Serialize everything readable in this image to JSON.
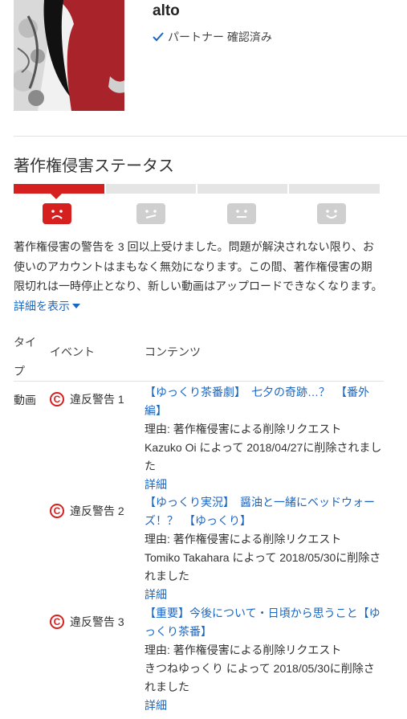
{
  "channel": {
    "name": "alto",
    "verified_label": "パートナー 確認済み"
  },
  "section_title": "著作権侵害ステータス",
  "status": {
    "level_index": 0,
    "levels": 4,
    "accent_color": "#d62020",
    "inactive_color": "#cfcfcf"
  },
  "description": {
    "text": "著作権侵害の警告を 3 回以上受けました。問題が解決されない限り、お使いのアカウントはまもなく無効になります。この間、著作権侵害の期限切れは一時停止となり、新しい動画はアップロードできなくなります。",
    "more_link": "詳細を表示"
  },
  "table": {
    "headers": {
      "type": "タイプ",
      "event": "イベント",
      "content": "コンテンツ"
    },
    "type_value": "動画",
    "rows": [
      {
        "event": "違反警告 1",
        "title": "【ゆっくり茶番劇】　七夕の奇跡…？　【番外編】",
        "reason": "理由: 著作権侵害による削除リクエスト",
        "removed_by": "Kazuko Oi によって 2018/04/27に削除されました",
        "details": "詳細"
      },
      {
        "event": "違反警告 2",
        "title": "【ゆっくり実況】　醤油と一緒にベッドウォーズ！？　【ゆっくり】",
        "reason": "理由: 著作権侵害による削除リクエスト",
        "removed_by": "Tomiko Takahara によって 2018/05/30に削除されました",
        "details": "詳細"
      },
      {
        "event": "違反警告 3",
        "title": "【重要】今後について・日頃から思うこと【ゆっくり茶番】",
        "reason": "理由: 著作権侵害による削除リクエスト",
        "removed_by": "きつねゆっくり によって 2018/05/30に削除されました",
        "details": "詳細"
      }
    ]
  }
}
